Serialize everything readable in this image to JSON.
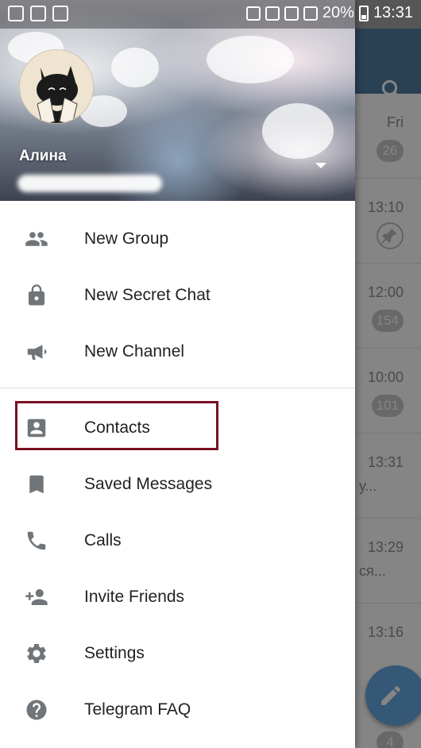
{
  "status_bar": {
    "battery": "20%",
    "time": "13:31"
  },
  "chat_list": {
    "rows": [
      {
        "time": "Fri",
        "badge": "26",
        "snippet": ""
      },
      {
        "time": "13:10",
        "badge": "",
        "snippet": ""
      },
      {
        "time": "12:00",
        "badge": "154",
        "snippet": ""
      },
      {
        "time": "10:00",
        "badge": "101",
        "snippet": ""
      },
      {
        "time": "13:31",
        "badge": "",
        "snippet": "у..."
      },
      {
        "time": "13:29",
        "badge": "",
        "snippet": "ся..."
      },
      {
        "time": "13:16",
        "badge": "",
        "snippet": ""
      },
      {
        "time": "",
        "badge": "4",
        "snippet": ""
      }
    ]
  },
  "drawer": {
    "user_name": "Алина",
    "menu": [
      {
        "label": "New Group",
        "icon": "group-icon"
      },
      {
        "label": "New Secret Chat",
        "icon": "lock-icon"
      },
      {
        "label": "New Channel",
        "icon": "megaphone-icon"
      },
      {
        "label": "Contacts",
        "icon": "contact-icon"
      },
      {
        "label": "Saved Messages",
        "icon": "bookmark-icon"
      },
      {
        "label": "Calls",
        "icon": "phone-icon"
      },
      {
        "label": "Invite Friends",
        "icon": "add-person-icon"
      },
      {
        "label": "Settings",
        "icon": "gear-icon"
      },
      {
        "label": "Telegram FAQ",
        "icon": "help-icon"
      }
    ]
  },
  "colors": {
    "app_bar": "#517da2",
    "fab": "#65a9e0",
    "icon": "#707579",
    "highlight": "#7a1022"
  }
}
